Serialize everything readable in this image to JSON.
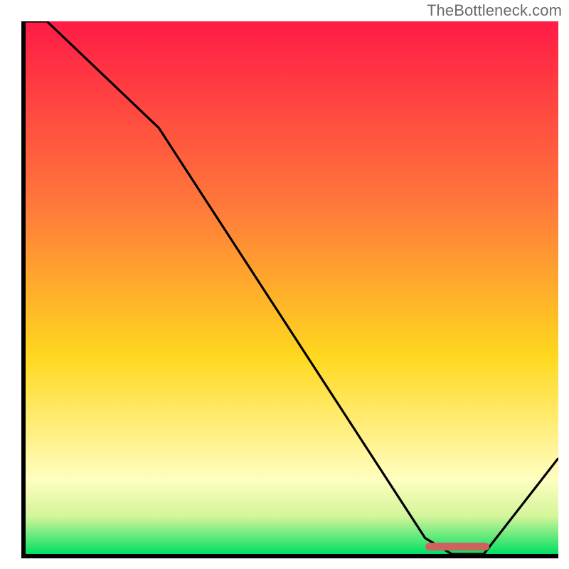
{
  "attribution": "TheBottleneck.com",
  "colors": {
    "gradient_top": "#ff1b46",
    "gradient_mid_upper": "#ff7a3a",
    "gradient_mid": "#ffd81f",
    "gradient_lower": "#fffec0",
    "gradient_bottom": "#00e062",
    "curve": "#000000",
    "axis": "#000000",
    "marker": "#cf6260"
  },
  "chart_data": {
    "type": "line",
    "title": "",
    "xlabel": "",
    "ylabel": "",
    "xlim": [
      0,
      100
    ],
    "ylim": [
      0,
      100
    ],
    "x": [
      0,
      4,
      25,
      75,
      80,
      86,
      100
    ],
    "values": [
      100,
      100,
      80,
      3,
      0,
      0,
      18
    ],
    "marker_range_x": [
      75,
      87
    ],
    "marker_y": 1,
    "gradient_stops": [
      {
        "offset": 0.0,
        "color": "#ff1b46"
      },
      {
        "offset": 0.35,
        "color": "#ff7a3a"
      },
      {
        "offset": 0.63,
        "color": "#ffd81f"
      },
      {
        "offset": 0.86,
        "color": "#fffec0"
      },
      {
        "offset": 0.93,
        "color": "#d2f59a"
      },
      {
        "offset": 1.0,
        "color": "#00e062"
      }
    ]
  }
}
